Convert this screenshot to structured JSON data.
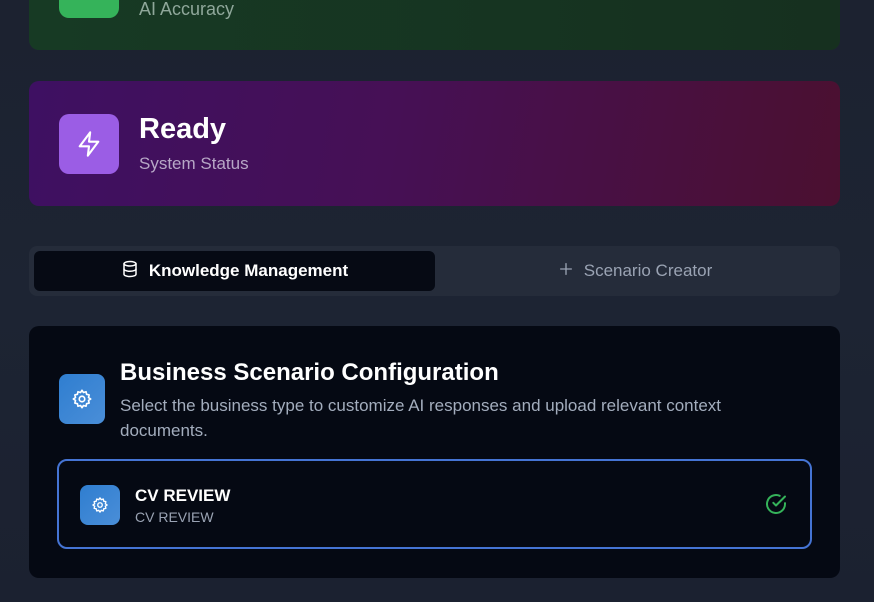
{
  "stats": {
    "accuracy": {
      "label": "AI Accuracy",
      "icon": "check-icon",
      "color": "#35b35a"
    },
    "status": {
      "value": "Ready",
      "label": "System Status",
      "icon": "lightning-icon",
      "color": "#9b5de5"
    }
  },
  "tabs": [
    {
      "label": "Knowledge Management",
      "icon": "database-icon",
      "active": true
    },
    {
      "label": "Scenario Creator",
      "icon": "plus-icon",
      "active": false
    }
  ],
  "config": {
    "title": "Business Scenario Configuration",
    "description": "Select the business type to customize AI responses and upload relevant context documents.",
    "icon": "gear-icon",
    "scenarios": [
      {
        "name": "CV REVIEW",
        "subtitle": "CV REVIEW",
        "icon": "gear-icon",
        "selected": true
      }
    ]
  },
  "colors": {
    "accent": "#4574d4",
    "success": "#35b35a",
    "purple": "#9b5de5"
  }
}
